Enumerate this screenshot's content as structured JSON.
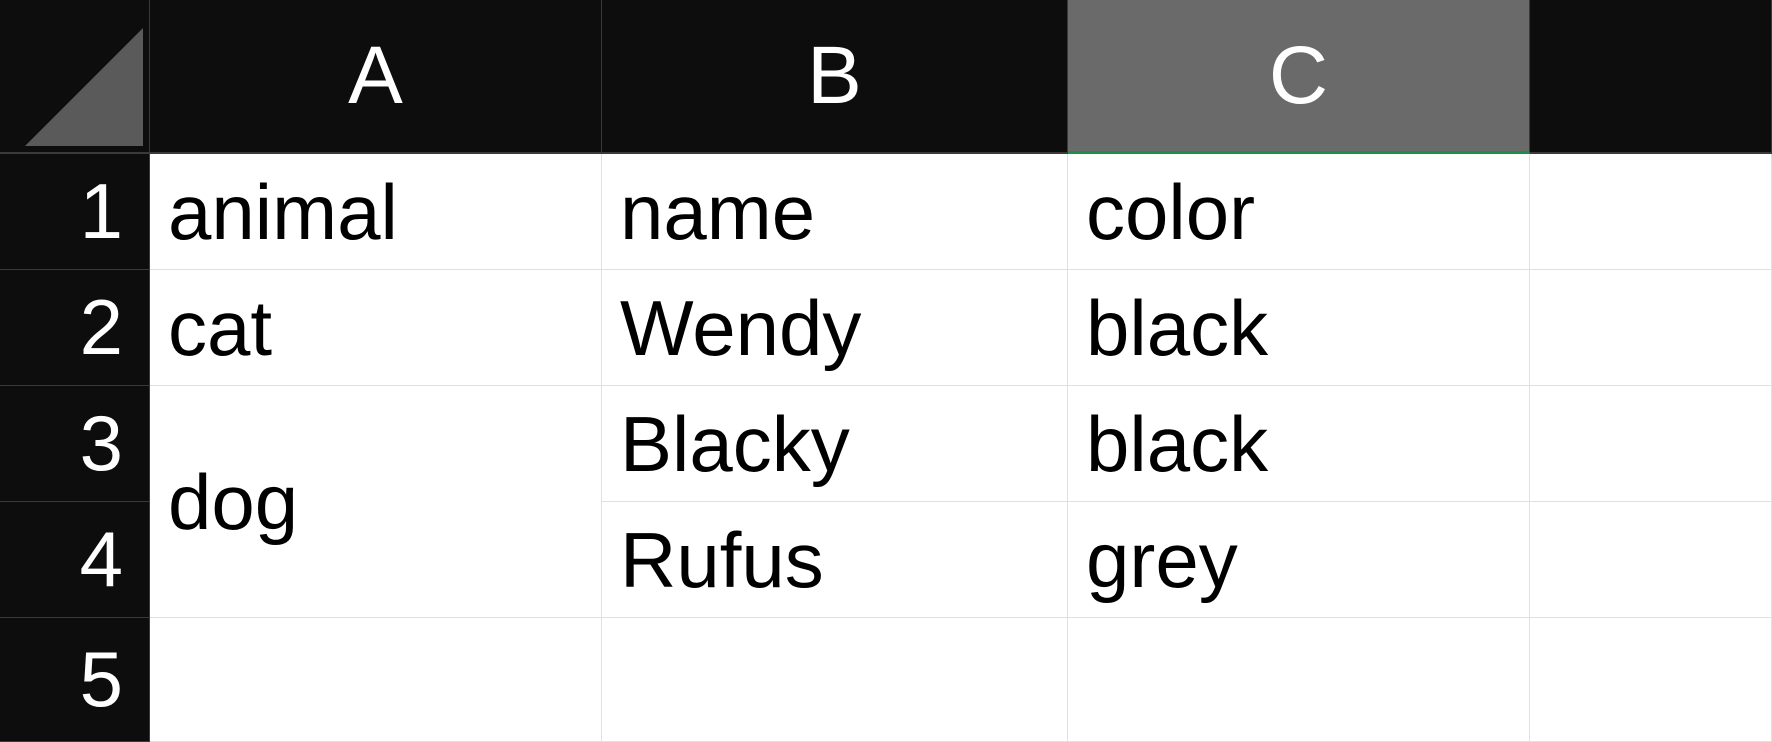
{
  "columns": {
    "A": "A",
    "B": "B",
    "C": "C",
    "D": ""
  },
  "rows": {
    "r1": "1",
    "r2": "2",
    "r3": "3",
    "r4": "4",
    "r5": "5"
  },
  "selected_column": "C",
  "grid": {
    "A1": "animal",
    "B1": "name",
    "C1": "color",
    "A2": "cat",
    "B2": "Wendy",
    "C2": "black",
    "A3_4": "dog",
    "B3": "Blacky",
    "C3": "black",
    "B4": "Rufus",
    "C4": "grey"
  },
  "chart_data": {
    "type": "table",
    "headers": [
      "animal",
      "name",
      "color"
    ],
    "rows": [
      {
        "animal": "cat",
        "name": "Wendy",
        "color": "black"
      },
      {
        "animal": "dog",
        "name": "Blacky",
        "color": "black"
      },
      {
        "animal": "dog",
        "name": "Rufus",
        "color": "grey"
      }
    ],
    "merges": [
      {
        "range": "A3:A4",
        "value": "dog"
      }
    ]
  }
}
